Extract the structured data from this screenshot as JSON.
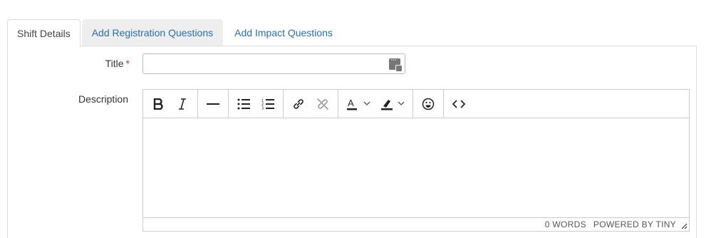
{
  "tabs": [
    {
      "label": "Shift Details",
      "active": true
    },
    {
      "label": "Add Registration Questions",
      "active": false
    },
    {
      "label": "Add Impact Questions",
      "active": false
    }
  ],
  "form": {
    "title_label": "Title",
    "required_marker": "*",
    "title_value": "",
    "description_label": "Description"
  },
  "editor": {
    "toolbar": [
      [
        "bold-icon",
        "italic-icon"
      ],
      [
        "horizontal-rule-icon"
      ],
      [
        "bullet-list-icon",
        "numbered-list-icon"
      ],
      [
        "link-icon",
        "unlink-icon"
      ],
      [
        "text-color-icon",
        "highlight-color-icon"
      ],
      [
        "emoji-icon"
      ],
      [
        "source-code-icon"
      ]
    ],
    "word_count": "0 WORDS",
    "powered_by": "POWERED BY TINY"
  },
  "colors": {
    "link": "#2a6fb0",
    "required": "#c0392b",
    "border": "#cccccc"
  }
}
